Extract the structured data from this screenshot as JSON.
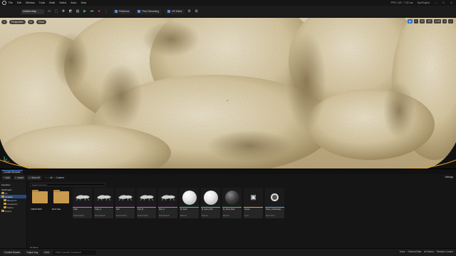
{
  "window": {
    "menu": [
      "File",
      "Edit",
      "Window",
      "Tools",
      "Build",
      "Select",
      "Actor",
      "Help"
    ],
    "project": "SpcProject",
    "stats_text": "FPS: 120 · 7.02 ms"
  },
  "toolbar": {
    "level_tab": "Untitled Map",
    "platforms_label": "Platforms",
    "pixel_streaming_label": "Pixel Streaming",
    "vr_label": "VR Editor"
  },
  "viewport": {
    "left_pills": [
      "Perspective",
      "Lit",
      "Show"
    ],
    "right_chips": [
      "▦",
      "⌖",
      "10",
      "10°",
      "0.25",
      "4"
    ],
    "active_chip_index": 0
  },
  "content_browser": {
    "tabs": [
      "Content Browser"
    ],
    "add_label": "Add",
    "import_label": "Import",
    "save_all_label": "Save All",
    "path": [
      "All",
      "Content"
    ],
    "settings_label": "Settings",
    "sidebar": {
      "favorites_label": "Favorites",
      "project_label": "SpcProject",
      "tree": [
        "All",
        "Content",
        "Blueprints",
        "Characters",
        "Starter",
        "Engine"
      ],
      "selected_index": 1
    },
    "search_placeholder": "Search Content",
    "items": [
      {
        "name": "CREATURES",
        "type": "",
        "kind": "folder",
        "stripe": ""
      },
      {
        "name": "Mesh data",
        "type": "",
        "kind": "folder",
        "stripe": ""
      },
      {
        "name": "Crab",
        "type": "Skeletal Mesh",
        "kind": "mesh",
        "stripe": "#e05fd0"
      },
      {
        "name": "Crab_A",
        "type": "Skeletal Mesh",
        "kind": "mesh",
        "stripe": "#e05fd0"
      },
      {
        "name": "Fish",
        "type": "Skeletal Mesh",
        "kind": "mesh",
        "stripe": "#e05fd0"
      },
      {
        "name": "Fish_B",
        "type": "Skeletal Mesh",
        "kind": "mesh",
        "stripe": "#e05fd0"
      },
      {
        "name": "Fish_C",
        "type": "Skeletal Mesh",
        "kind": "mesh",
        "stripe": "#e05fd0"
      },
      {
        "name": "M_Sand",
        "type": "Material",
        "kind": "sphere-white",
        "stripe": "#3dc96d"
      },
      {
        "name": "M_Sand_Wet",
        "type": "Material",
        "kind": "sphere-white",
        "stripe": "#3dc96d"
      },
      {
        "name": "M_Sand_Dark",
        "type": "Material",
        "kind": "sphere-dark",
        "stripe": "#3dc96d"
      },
      {
        "name": "Ocean",
        "type": "Level",
        "kind": "level",
        "stripe": "#e6a23c"
      },
      {
        "name": "Plane_Underwater",
        "type": "Static Mesh",
        "kind": "static",
        "stripe": "#35b8e8"
      }
    ],
    "item_count": "12 items"
  },
  "statusbar": {
    "drawer_label": "Content Drawer",
    "output_label": "Output Log",
    "cmd_label": "Cmd",
    "cmd_placeholder": "Enter Console Command",
    "right": [
      "Trace",
      "Derived Data",
      "All Saved",
      "Revision Control"
    ]
  },
  "colors": {
    "accent": "#2f6fd0",
    "folder": "#c89a4e",
    "play": "#3cc43c"
  }
}
